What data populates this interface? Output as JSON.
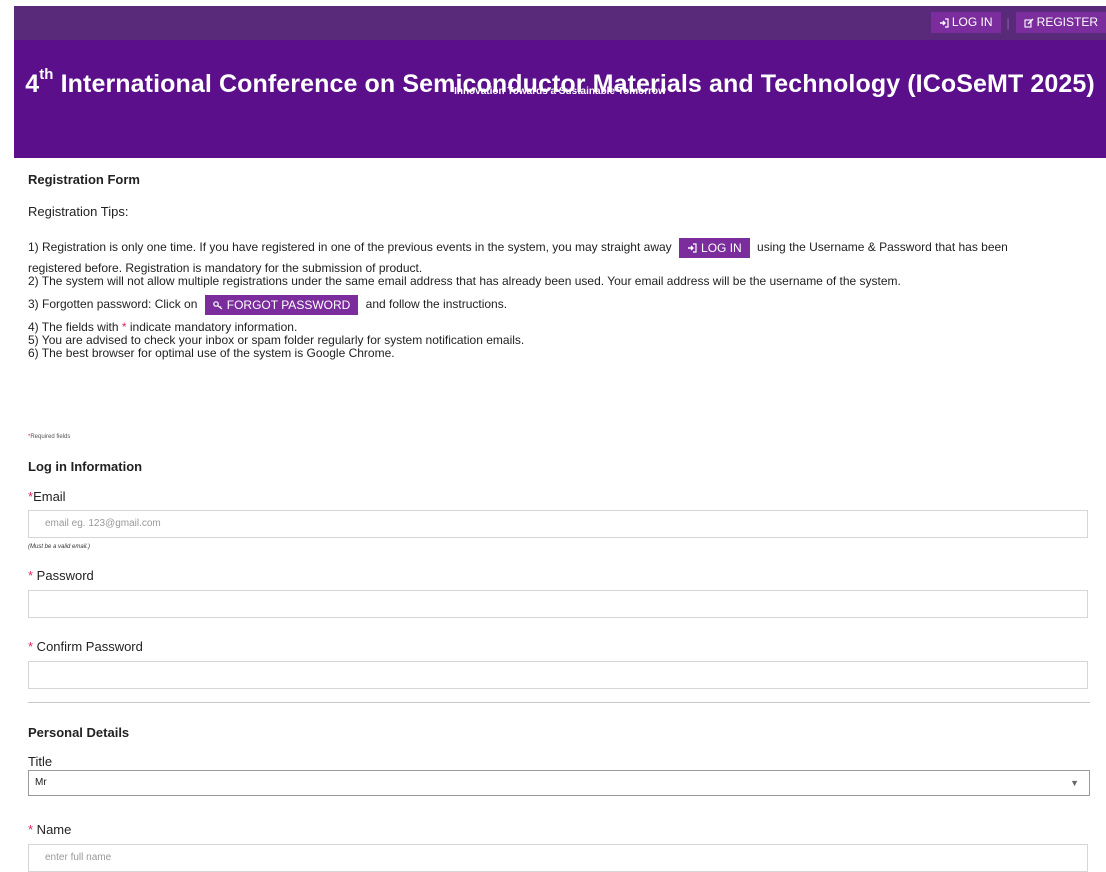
{
  "nav": {
    "login_label": "LOG IN",
    "register_label": "REGISTER",
    "separator": "|"
  },
  "banner": {
    "title_ordinal": "4",
    "title_sup": "th",
    "title_rest": " International Conference on Semiconductor Materials and Technology (ICoSeMT 2025)",
    "subtitle": "Innovation Towards a Sustainable Tomorrow"
  },
  "form": {
    "heading": "Registration Form",
    "tips_heading": "Registration Tips:",
    "tip1_a": "1) Registration is only one time. If you have registered in one of the previous events in the system, you may straight away",
    "tip1_btn": "LOG IN",
    "tip1_b": "using the Username & Password that has been",
    "tip1_c": "registered before. Registration is mandatory for the submission of product.",
    "tip2": "2) The system will not allow multiple registrations under the same email address that has already been used. Your email address will be the username of the system.",
    "tip3_a": "3) Forgotten password: Click on",
    "tip3_btn": "FORGOT PASSWORD",
    "tip3_b": "and follow the instructions.",
    "tip4_a": "4) The fields with",
    "tip4_star": "*",
    "tip4_b": "indicate mandatory information.",
    "tip5": "5) You are advised to check your inbox or spam folder regularly for system notification emails.",
    "tip6": "6) The best browser for optimal use of the system is Google Chrome.",
    "required_note_star": "*",
    "required_note": "Required fields",
    "login_section": "Log in Information",
    "email_star": "*",
    "email_label": "Email",
    "email_placeholder": "email eg. 123@gmail.com",
    "email_hint": "(Must be a valid email.)",
    "password_star": "*",
    "password_label": " Password",
    "confirm_star": "*",
    "confirm_label": " Confirm Password",
    "personal_section": "Personal Details",
    "title_label": "Title",
    "title_value": "Mr",
    "name_star": "*",
    "name_label": " Name",
    "name_placeholder": "enter full name"
  },
  "colors": {
    "topbar": "#5a2a7a",
    "banner": "#5b0f8a",
    "button": "#7b2d9e",
    "required": "#e0245e"
  },
  "icons": [
    "login-icon",
    "edit-icon",
    "key-icon",
    "chevron-down-icon"
  ]
}
